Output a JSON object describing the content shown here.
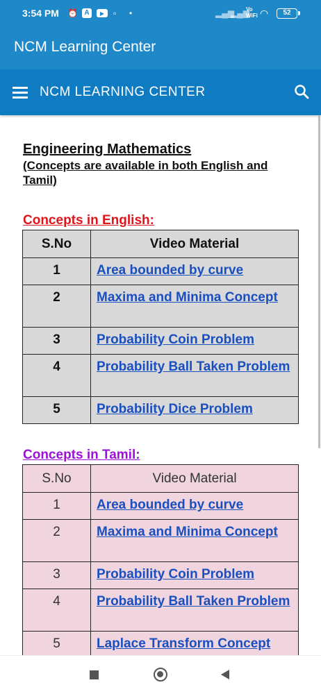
{
  "status_bar": {
    "time": "3:54 PM",
    "battery": "52",
    "vowifi": "Vo WiFi"
  },
  "app_bar": {
    "title": "NCM Learning Center"
  },
  "nav_bar": {
    "brand": "NCM LEARNING CENTER"
  },
  "page": {
    "heading": "Engineering Mathematics",
    "subheading": "(Concepts are available in both English and Tamil)"
  },
  "english": {
    "title": "Concepts in English:",
    "title_color": "#e0141c",
    "header_bg": "#d9d9d9",
    "row_bg": "#d9d9d9",
    "columns": [
      "S.No",
      "Video Material"
    ],
    "rows": [
      {
        "sno": "1",
        "title": "Area bounded by curve"
      },
      {
        "sno": "2",
        "title": "Maxima and Minima Concept"
      },
      {
        "sno": "3",
        "title": "Probability Coin Problem"
      },
      {
        "sno": "4",
        "title": "Probability Ball Taken Problem"
      },
      {
        "sno": "5",
        "title": "Probability Dice Problem"
      }
    ]
  },
  "tamil": {
    "title": "Concepts in Tamil:",
    "title_color": "#9b12d6",
    "header_bg": "#f0d4de",
    "row_bg": "#f0d4de",
    "columns": [
      "S.No",
      "Video Material"
    ],
    "rows": [
      {
        "sno": "1",
        "title": "Area bounded by curve"
      },
      {
        "sno": "2",
        "title": "Maxima and Minima Concept"
      },
      {
        "sno": "3",
        "title": "Probability Coin Problem"
      },
      {
        "sno": "4",
        "title": "Probability Ball Taken Problem"
      },
      {
        "sno": "5",
        "title": "Laplace Transform Concept"
      }
    ]
  }
}
